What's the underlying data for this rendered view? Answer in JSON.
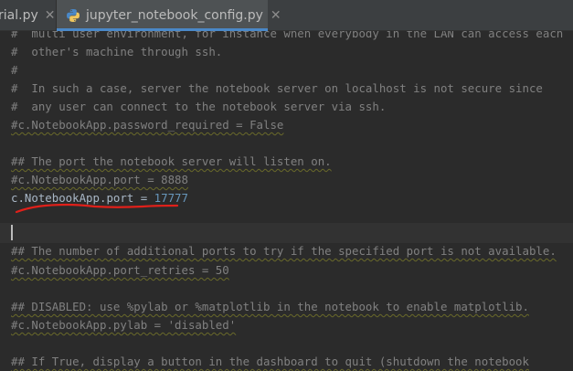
{
  "tabs": [
    {
      "label": "rial.py",
      "close": "✕",
      "active": false
    },
    {
      "label": "jupyter_notebook_config.py",
      "close": "✕",
      "active": true
    }
  ],
  "editor": {
    "lines": [
      "#  multi user environment, for instance when everybody in the LAN can access each",
      "#  other's machine through ssh.",
      "#",
      "#  In such a case, server the notebook server on localhost is not secure since",
      "#  any user can connect to the notebook server via ssh.",
      "#c.NotebookApp.password_required = False",
      "## The port the notebook server will listen on.",
      "#c.NotebookApp.port = 8888",
      "## The number of additional ports to try if the specified port is not available.",
      "#c.NotebookApp.port_retries = 50",
      "## DISABLED: use %pylab or %matplotlib in the notebook to enable matplotlib.",
      "#c.NotebookApp.pylab = 'disabled'",
      "## If True, display a button in the dashboard to quit (shutdown the notebook"
    ],
    "active_code": {
      "prefix": "c.",
      "name": "NotebookApp.port",
      "operator": " = ",
      "value": "17777"
    }
  },
  "colors": {
    "background": "#2b2b2b",
    "tabbar": "#3c3f41",
    "active_tab": "#4e5254",
    "tab_underline": "#4a88c7",
    "comment": "#808080",
    "code": "#a9b7c6",
    "number": "#6897bb",
    "annotation": "#e0201a"
  },
  "icons": {
    "file_type": "python-file-icon",
    "tab_close": "close-icon",
    "markup": "red-underline-annotation"
  }
}
